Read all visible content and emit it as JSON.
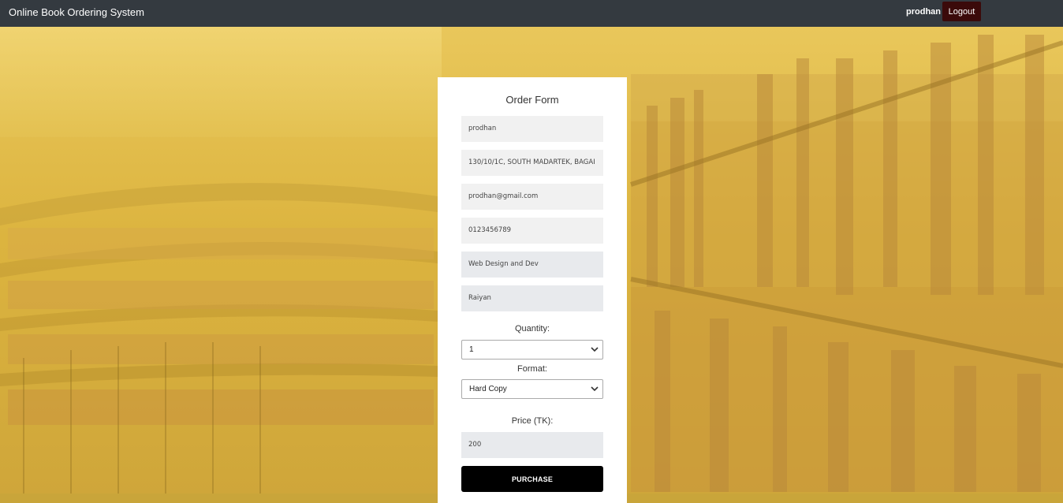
{
  "navbar": {
    "brand": "Online Book Ordering System",
    "username": "prodhan",
    "logout_label": "Logout"
  },
  "form": {
    "title": "Order Form",
    "name": "prodhan",
    "address": "130/10/1C, SOUTH MADARTEK, BAGAI",
    "email": "prodhan@gmail.com",
    "phone": "0123456789",
    "book_title": "Web Design and Dev",
    "author": "Raiyan",
    "quantity_label": "Quantity:",
    "quantity_value": "1",
    "format_label": "Format:",
    "format_value": "Hard Copy",
    "price_label": "Price (TK):",
    "price_value": "200",
    "purchase_label": "PURCHASE"
  },
  "colors": {
    "navbar_bg": "#343a40",
    "logout_bg": "#3b0a0a",
    "background_tint": "#e2bf4d",
    "purchase_bg": "#000000"
  }
}
